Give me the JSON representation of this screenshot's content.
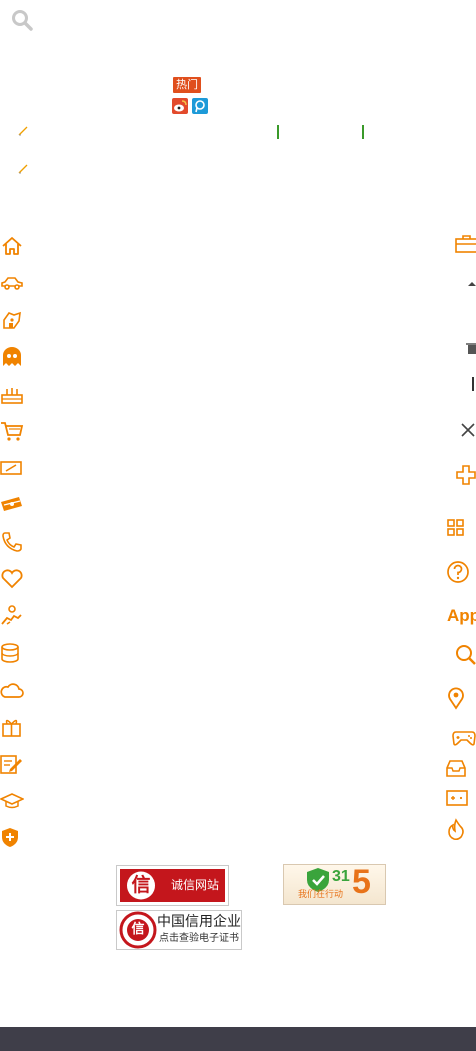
{
  "header": {
    "search_icon": "search-icon"
  },
  "promo": {
    "hot_label": "热门",
    "share_icons": [
      "weibo-icon",
      "tencent-weibo-icon"
    ]
  },
  "left_icons": [
    "home-icon",
    "car-icon",
    "pet-icon",
    "ghost-icon",
    "cake-icon",
    "cart-icon",
    "ticket-icon",
    "money-icon",
    "phone-icon",
    "heart-icon",
    "handshake-icon",
    "coins-icon",
    "cloud-icon",
    "gift-icon",
    "edit-icon",
    "graduation-icon",
    "shield-plus-icon"
  ],
  "right_icons": [
    "briefcase-icon",
    "caret-up-icon",
    "trash-icon",
    "bar-icon",
    "close-icon",
    "plus-cross-icon",
    "grid-icon",
    "help-icon",
    "app-icon",
    "search-icon",
    "location-icon",
    "gamepad-icon",
    "inbox-icon",
    "card-icon",
    "fire-icon"
  ],
  "right_app_text": "App",
  "badges": {
    "trust_label": "诚信网站",
    "trust_seal": "信",
    "b315_number": "315",
    "b315_big": "5",
    "b315_number_small": "31",
    "b315_text": "我们在行动",
    "credit_title": "中国信用企业",
    "credit_sub": "点击查验电子证书",
    "credit_seal": "信"
  },
  "colors": {
    "accent": "#f08300",
    "search_gray": "#c8c8c8",
    "hot_red": "#e04f1d",
    "footer": "#3f3e49"
  }
}
